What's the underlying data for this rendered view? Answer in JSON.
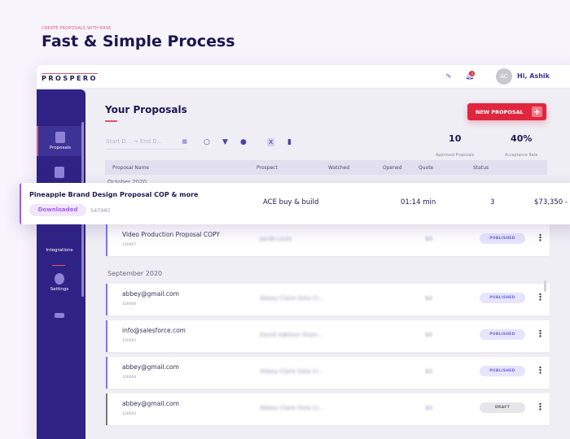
{
  "hero": {
    "eyebrow": "CREATE PROPOSALS WITH EASE",
    "headline": "Fast & Simple Process"
  },
  "topbar": {
    "logo": "PROSPERO",
    "notification_count": "3",
    "avatar_initials": "AC",
    "greeting": "Hi, Ashik"
  },
  "sidebar": {
    "items": [
      {
        "label": "Proposals"
      },
      {
        "label": "Integrations"
      },
      {
        "label": "Settings"
      }
    ]
  },
  "main": {
    "title": "Your Proposals",
    "new_button": "NEW PROPOSAL",
    "new_button_icon": "+",
    "date_start": "Start D...",
    "date_arrow": "→",
    "date_end": "End D...",
    "stats": [
      {
        "value": "10",
        "label": "Approved Proposals"
      },
      {
        "value": "40%",
        "label": "Acceptance Rate"
      }
    ],
    "columns": [
      "Proposal Name",
      "Prospect",
      "Watched",
      "Opened",
      "Quote",
      "Status"
    ],
    "months": [
      "October 2020",
      "September 2020"
    ],
    "highlight": {
      "name": "Pineapple Brand Design Proposal COP & more",
      "status": "Downloaded",
      "id": "547987",
      "prospect": "ACE buy & build",
      "watched": "01:14 min",
      "opened": "3",
      "quote": "$73,350 -"
    },
    "rows": [
      {
        "name": "Video Production Proposal COPY",
        "id": "100007",
        "prospect": "Jacob Louis",
        "quote": "$0",
        "status": "PUBLISHED"
      },
      {
        "name": "abbey@gmail.com",
        "id": "100006",
        "prospect": "Abbey Claire Dela Cr...",
        "quote": "$0",
        "status": "PUBLISHED"
      },
      {
        "name": "info@salesforce.com",
        "id": "100005",
        "prospect": "David Adelson Diam...",
        "quote": "$0",
        "status": "PUBLISHED"
      },
      {
        "name": "abbey@gmail.com",
        "id": "100004",
        "prospect": "Abbey Claire Dela Cr...",
        "quote": "$0",
        "status": "PUBLISHED"
      },
      {
        "name": "abbey@gmail.com",
        "id": "100003",
        "prospect": "Abbey Claire Dela Cr...",
        "quote": "$0",
        "status": "DRAFT"
      }
    ]
  }
}
